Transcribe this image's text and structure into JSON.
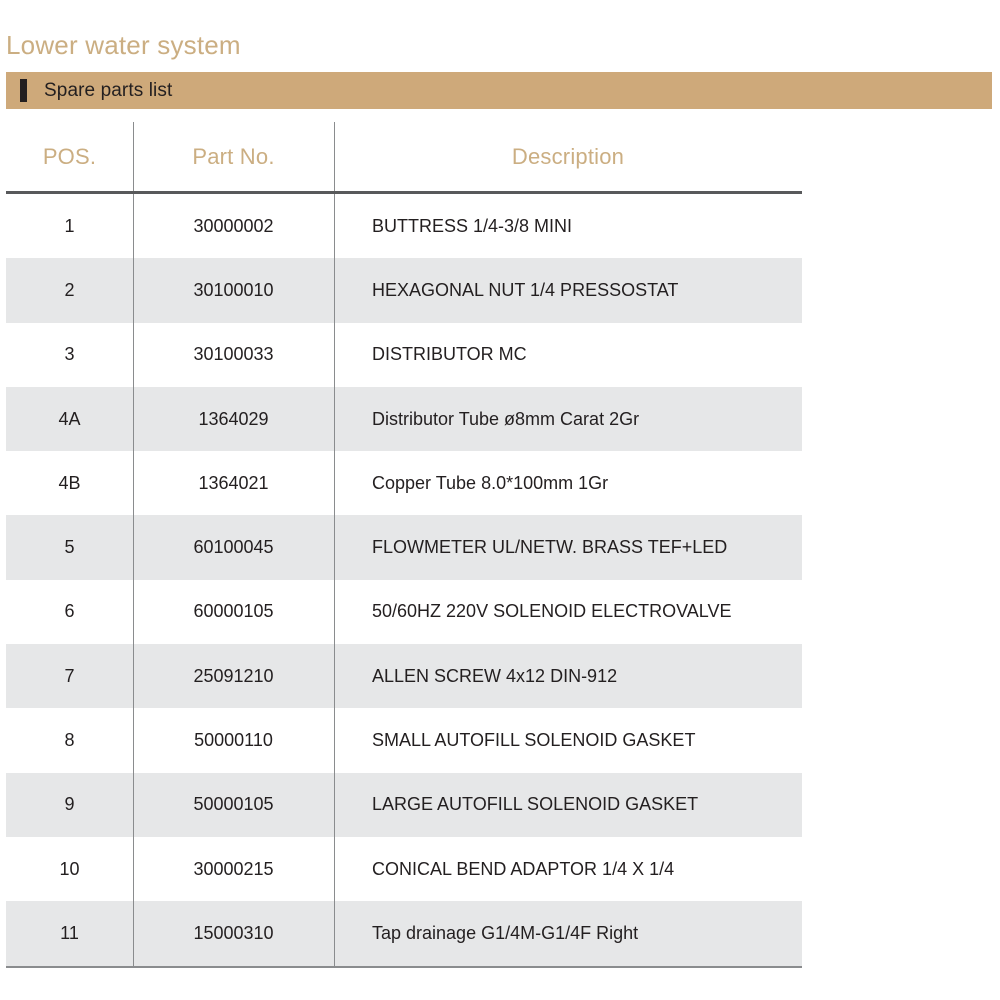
{
  "page": {
    "title": "Lower water system"
  },
  "banner": {
    "label": "Spare parts list",
    "background_color": "#CEA97A",
    "marker_color": "#231F20"
  },
  "theme": {
    "accent_color": "#CBAE82",
    "text_color": "#231F20",
    "rule_color": "#58595B",
    "row_alt_color": "#E6E7E8"
  },
  "table": {
    "columns": [
      {
        "key": "pos",
        "label": "POS."
      },
      {
        "key": "part_no",
        "label": "Part No."
      },
      {
        "key": "description",
        "label": "Description"
      }
    ],
    "rows": [
      {
        "pos": "1",
        "part_no": "30000002",
        "description": "BUTTRESS 1/4-3/8 MINI"
      },
      {
        "pos": "2",
        "part_no": "30100010",
        "description": "HEXAGONAL NUT 1/4 PRESSOSTAT"
      },
      {
        "pos": "3",
        "part_no": "30100033",
        "description": "DISTRIBUTOR MC"
      },
      {
        "pos": "4A",
        "part_no": "1364029",
        "description": "Distributor Tube ø8mm Carat 2Gr"
      },
      {
        "pos": "4B",
        "part_no": "1364021",
        "description": "Copper Tube  8.0*100mm 1Gr"
      },
      {
        "pos": "5",
        "part_no": "60100045",
        "description": "FLOWMETER UL/NETW. BRASS TEF+LED"
      },
      {
        "pos": "6",
        "part_no": "60000105",
        "description": "50/60HZ 220V SOLENOID ELECTROVALVE"
      },
      {
        "pos": "7",
        "part_no": "25091210",
        "description": "ALLEN SCREW 4x12 DIN-912"
      },
      {
        "pos": "8",
        "part_no": "50000110",
        "description": "SMALL AUTOFILL SOLENOID GASKET"
      },
      {
        "pos": "9",
        "part_no": "50000105",
        "description": "LARGE AUTOFILL SOLENOID GASKET"
      },
      {
        "pos": "10",
        "part_no": "30000215",
        "description": "CONICAL BEND ADAPTOR 1/4 X 1/4"
      },
      {
        "pos": "11",
        "part_no": "15000310",
        "description": "Tap drainage G1/4M-G1/4F Right"
      }
    ]
  }
}
